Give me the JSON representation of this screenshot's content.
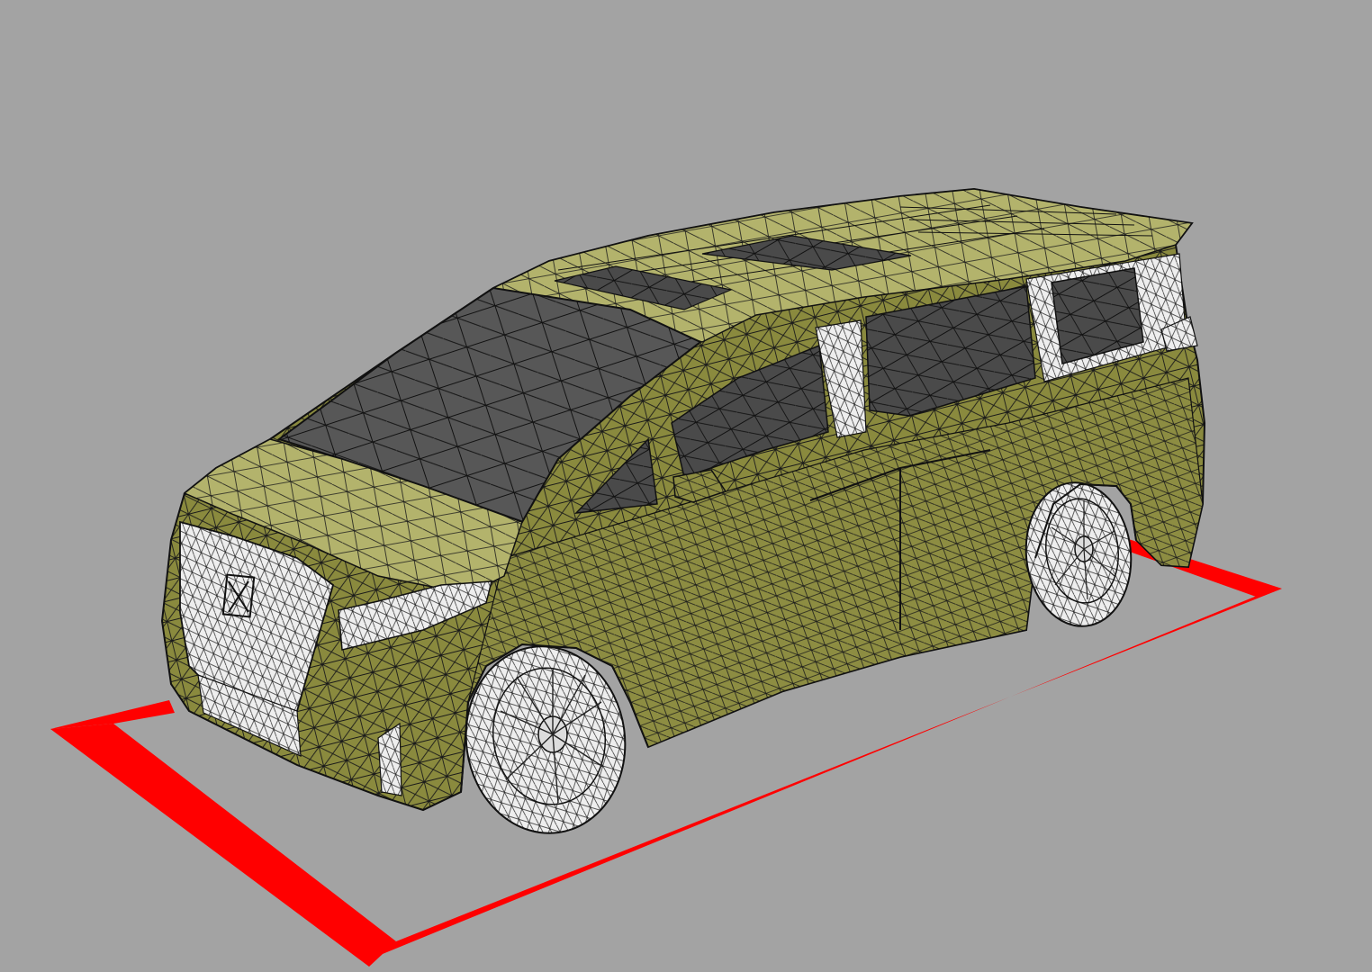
{
  "viewport": {
    "background_color": "#a3a3a3",
    "projection": "perspective",
    "render_mode": "shaded-wireframe"
  },
  "model": {
    "subject": "minivan",
    "body_color": "#8a8a3e",
    "body_highlight_color": "#a9a962",
    "glass_color": "#555555",
    "trim_color": "#ececec",
    "wire_color": "#111111"
  },
  "ground_marker": {
    "shape": "rectangle",
    "color": "#ff0000"
  }
}
